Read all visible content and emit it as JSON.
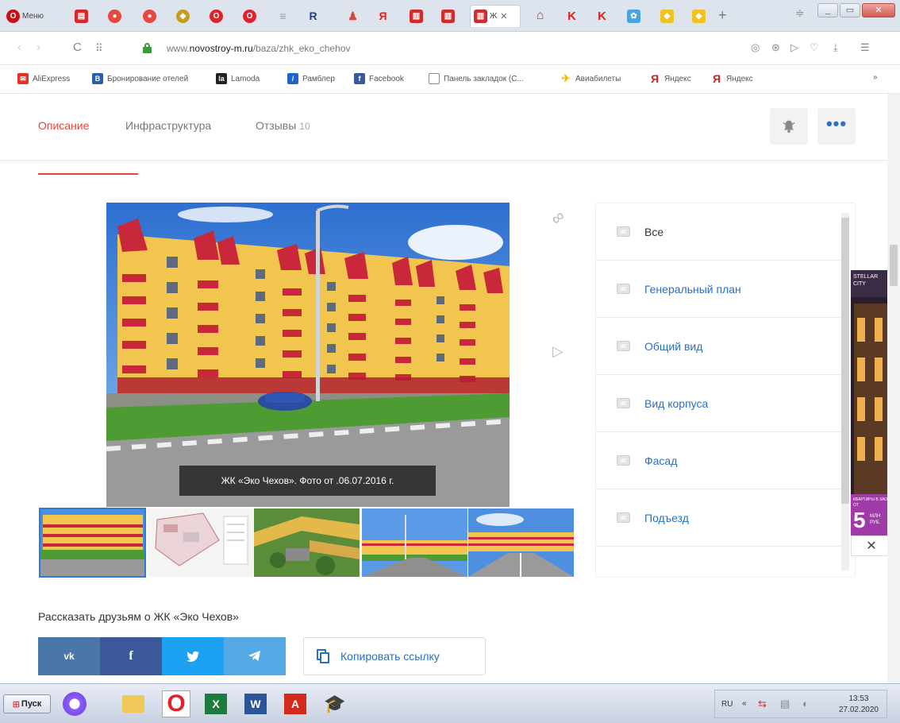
{
  "browser": {
    "tabs": [
      {
        "label": "Меню",
        "icon": "opera-menu-icon",
        "color": "#cc0f16"
      },
      {
        "label": "",
        "icon": "pdf-icon",
        "color": "#d6272d"
      },
      {
        "label": "",
        "icon": "red-circle-icon",
        "color": "#e94640"
      },
      {
        "label": "",
        "icon": "red-circle-icon",
        "color": "#e94640"
      },
      {
        "label": "",
        "icon": "yellow-icon",
        "color": "#c79b1c"
      },
      {
        "label": "",
        "icon": "opera-o-icon",
        "color": "#e1222b"
      },
      {
        "label": "",
        "icon": "opera-o-icon",
        "color": "#e1222b"
      },
      {
        "label": "",
        "icon": "menu-icon",
        "color": "#8a9ab0"
      },
      {
        "label": "",
        "icon": "rutube-icon",
        "color": "#263e76"
      },
      {
        "label": "",
        "icon": "figure-icon",
        "color": "#d44a3a"
      },
      {
        "label": "",
        "icon": "yandex-icon",
        "color": "#e11d1d"
      },
      {
        "label": "",
        "icon": "book-icon",
        "color": "#d22d2d"
      },
      {
        "label": "",
        "icon": "book-icon",
        "color": "#d22d2d"
      },
      {
        "label": "Ж",
        "icon": "zhk-icon",
        "color": "#d22d2d"
      },
      {
        "label": "",
        "icon": "house-icon",
        "color": "#d22d2d"
      },
      {
        "label": "",
        "icon": "k-icon",
        "color": "#e11d1d"
      },
      {
        "label": "",
        "icon": "k-icon",
        "color": "#e11d1d"
      },
      {
        "label": "",
        "icon": "colorful-icon",
        "color": "#4aa3df"
      },
      {
        "label": "",
        "icon": "yellow-icon",
        "color": "#f0c420"
      },
      {
        "label": "",
        "icon": "yellow-icon",
        "color": "#f0c420"
      }
    ],
    "url_prefix": "www.",
    "url_domain": "novostroy-m.ru",
    "url_path": "/baza/zhk_eko_chehov",
    "bookmarks": [
      {
        "label": "AliExpress",
        "color": "#e43225"
      },
      {
        "label": "Бронирование отелей",
        "color": "#2b5fa8"
      },
      {
        "label": "Lamoda",
        "color": "#222222"
      },
      {
        "label": "Рамблер",
        "color": "#1f64c8"
      },
      {
        "label": "Facebook",
        "color": "#3a5998"
      },
      {
        "label": "Панель закладок (С...",
        "color": "#ffffff"
      },
      {
        "label": "Авиабилеты",
        "color": "#f0b900"
      },
      {
        "label": "Яндекс",
        "color": "#e11d1d"
      },
      {
        "label": "Яндекс",
        "color": "#e11d1d"
      }
    ],
    "bookmarks_more": "»"
  },
  "page": {
    "subtabs": {
      "description": "Описание",
      "infrastructure": "Инфраструктура",
      "reviews": "Отзывы",
      "reviews_count": "10"
    },
    "photo_caption": "ЖК «Эко Чехов». Фото от .06.07.2016 г.",
    "categories": [
      "Все",
      "Генеральный план",
      "Общий вид",
      "Вид корпуса",
      "Фасад",
      "Подъезд"
    ],
    "share_title": "Рассказать друзьям о ЖК «Эко Чехов»",
    "share_buttons": [
      {
        "label": "vk",
        "color": "#4a76a8"
      },
      {
        "label": "f",
        "color": "#3b5998"
      },
      {
        "label": "tw",
        "color": "#1da1f2"
      },
      {
        "label": "tg",
        "color": "#54a9e4"
      }
    ],
    "copy_link": "Копировать ссылку",
    "accent": "#e0463d",
    "link_color": "#2a6fbf",
    "ad": {
      "brand": "STELLAR CITY",
      "promo": "КВАРТИРЫ В ЗАО ОТ",
      "number": "5",
      "unit": "МЛН РУБ."
    }
  },
  "taskbar": {
    "start": "Пуск",
    "lang": "RU",
    "time": "13:53",
    "date": "27.02.2020"
  }
}
